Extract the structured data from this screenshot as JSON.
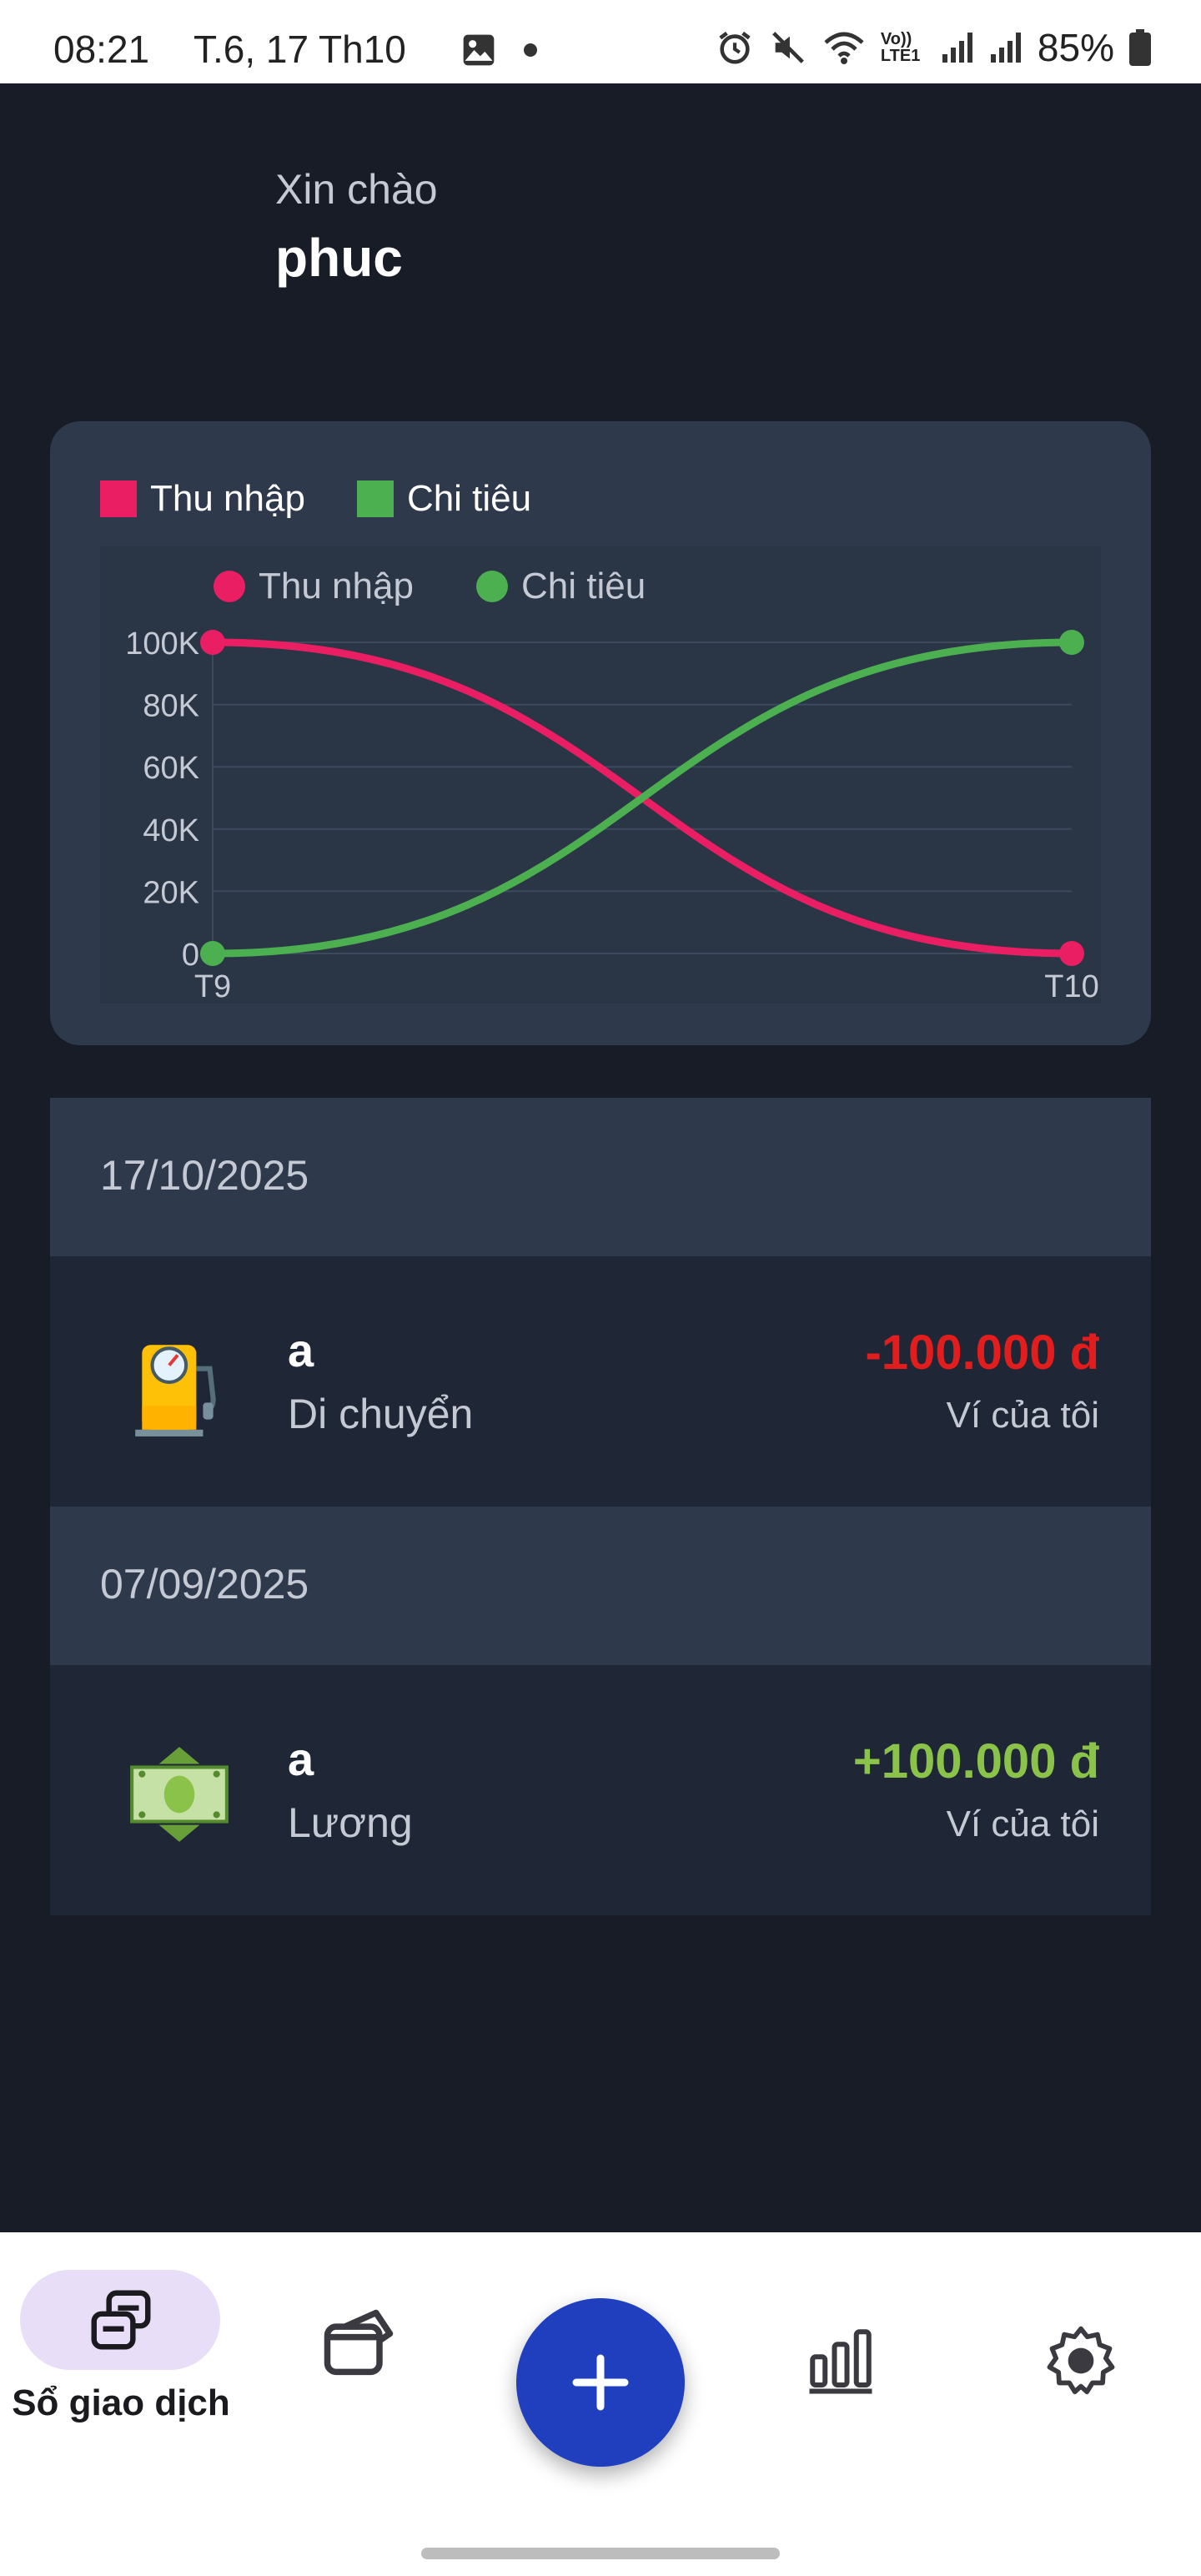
{
  "status_bar": {
    "time": "08:21",
    "date": "T.6, 17 Th10",
    "battery": "85%",
    "lte_label": "Vo)) LTE1"
  },
  "greeting": {
    "subtitle": "Xin chào",
    "name": "phuc"
  },
  "card_legend": [
    {
      "label": "Thu nhập",
      "color": "#e91e63"
    },
    {
      "label": "Chi tiêu",
      "color": "#4caf50"
    }
  ],
  "chart_data": {
    "type": "line",
    "x": [
      "T9",
      "T10"
    ],
    "series": [
      {
        "name": "Thu nhập",
        "color": "#e91e63",
        "values": [
          100000,
          0
        ]
      },
      {
        "name": "Chi tiêu",
        "color": "#4caf50",
        "values": [
          0,
          100000
        ]
      }
    ],
    "y_ticks": [
      "0",
      "20K",
      "40K",
      "60K",
      "80K",
      "100K"
    ],
    "ylim": [
      0,
      100000
    ],
    "grid": true,
    "legend": "top",
    "smooth": true
  },
  "transactions": [
    {
      "date": "17/10/2025",
      "title": "a",
      "category": "Di chuyển",
      "amount": "-100.000 đ",
      "amount_color": "#e11d1d",
      "wallet": "Ví của tôi",
      "icon": "fuel-pump-icon"
    },
    {
      "date": "07/09/2025",
      "title": "a",
      "category": "Lương",
      "amount": "+100.000 đ",
      "amount_color": "#8bc34a",
      "wallet": "Ví của tôi",
      "icon": "salary-money-icon"
    }
  ],
  "bottom_nav": {
    "active_label": "Sổ giao dịch",
    "items": [
      "transactions-ledger-icon",
      "wallet-icon",
      "add-icon",
      "stats-icon",
      "settings-icon"
    ]
  }
}
